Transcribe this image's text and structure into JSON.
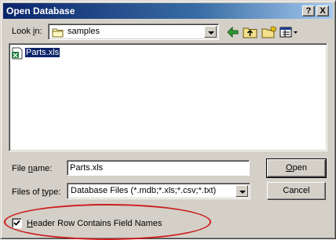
{
  "window": {
    "title": "Open Database",
    "help_label": "?",
    "close_label": "X"
  },
  "lookin": {
    "label_prefix": "Look ",
    "label_accel": "i",
    "label_suffix": "n:",
    "value": "samples"
  },
  "toolbar": {
    "icons": [
      "back-arrow-icon",
      "up-folder-icon",
      "new-folder-icon",
      "view-menu-icon"
    ]
  },
  "files": [
    {
      "name": "Parts.xls",
      "selected": true,
      "icon": "excel-file-icon"
    }
  ],
  "filename": {
    "label_prefix": "File ",
    "label_accel": "n",
    "label_suffix": "ame:",
    "value": "Parts.xls"
  },
  "filetype": {
    "label_prefix": "Files of ",
    "label_accel": "t",
    "label_suffix": "ype:",
    "value": "Database Files (*.mdb;*.xls;*.csv;*.txt)"
  },
  "buttons": {
    "open_accel": "O",
    "open_rest": "pen",
    "cancel": "Cancel"
  },
  "header_row": {
    "checked": true,
    "label_accel": "H",
    "label_rest": "eader Row Contains Field Names"
  },
  "colors": {
    "face": "#d4d0c8",
    "title_start": "#0a246a",
    "title_end": "#a6caf0",
    "selection": "#0a246a",
    "highlight_oval": "#cc1c1c"
  }
}
